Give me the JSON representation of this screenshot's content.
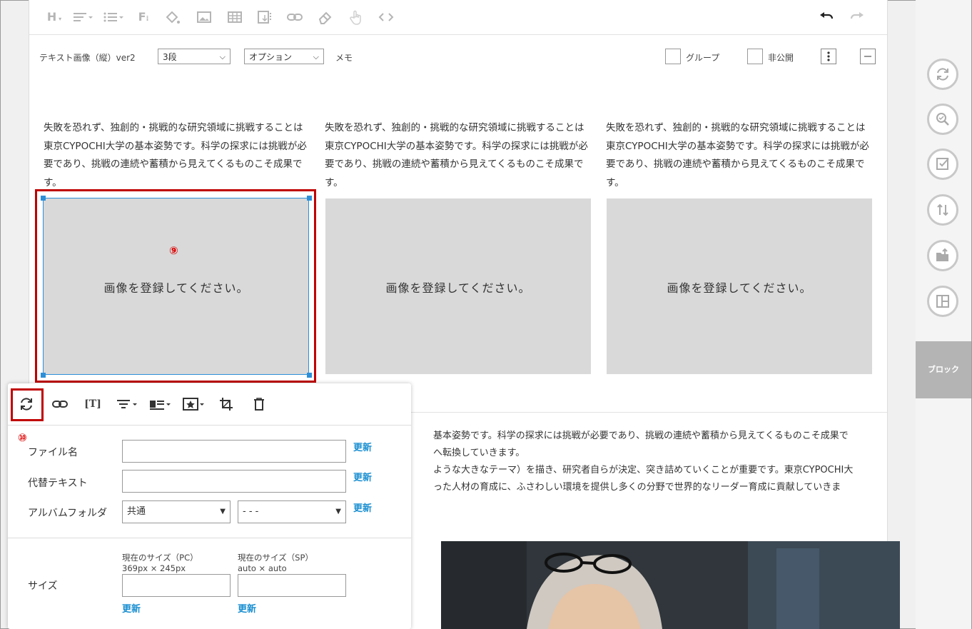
{
  "toolbar": {
    "icons": [
      "heading-icon",
      "align-icon",
      "list-icon",
      "font-icon",
      "fill-color-icon",
      "image-icon",
      "table-icon",
      "file-icon",
      "link-icon",
      "eraser-icon",
      "hand-icon",
      "code-icon",
      "undo-icon",
      "redo-icon"
    ],
    "heading_letter": "H",
    "font_letter": "F"
  },
  "block": {
    "name": "テキスト画像（縦）ver2",
    "columns_value": "3段",
    "option_value": "オプション",
    "memo_label": "メモ",
    "group_label": "グループ",
    "private_label": "非公開"
  },
  "columns": [
    {
      "text": "失敗を恐れず、独創的・挑戦的な研究領域に挑戦することは東京CYPOCHI大学の基本姿勢です。科学の探求には挑戦が必要であり、挑戦の連続や蓄積から見えてくるものこそ成果です。",
      "placeholder": "画像を登録してください。"
    },
    {
      "text": "失敗を恐れず、独創的・挑戦的な研究領域に挑戦することは東京CYPOCHI大学の基本姿勢です。科学の探求には挑戦が必要であり、挑戦の連続や蓄積から見えてくるものこそ成果です。",
      "placeholder": "画像を登録してください。"
    },
    {
      "text": "失敗を恐れず、独創的・挑戦的な研究領域に挑戦することは東京CYPOCHI大学の基本姿勢です。科学の探求には挑戦が必要であり、挑戦の連続や蓄積から見えてくるものこそ成果です。",
      "placeholder": "画像を登録してください。"
    }
  ],
  "markers": {
    "image": "⑨",
    "refresh": "⑩"
  },
  "paragraph": {
    "line1": "基本姿勢です。科学の探求には挑戦が必要であり、挑戦の連続や蓄積から見えてくるものこそ成果で",
    "line2": "へ転換していきます。",
    "line3": "ような大きなテーマ）を描き、研究者自らが決定、突き詰めていくことが重要です。東京CYPOCHI大",
    "line4": "った人材の育成に、ふさわしい環境を提供し多くの分野で世界的なリーダー育成に貢献していきま"
  },
  "right_panel": {
    "icons": [
      "refresh-icon",
      "zoom-icon",
      "checkbox-icon",
      "sort-icon",
      "folder-upload-icon",
      "layout-icon"
    ],
    "block_label": "ブロック"
  },
  "popup": {
    "tools": [
      "refresh-icon",
      "link-icon",
      "text-icon",
      "align-icon",
      "layout-icon",
      "star-icon",
      "crop-icon",
      "trash-icon"
    ],
    "text_tool_glyph": "T",
    "filename_label": "ファイル名",
    "filename_value": "",
    "alt_label": "代替テキスト",
    "alt_value": "",
    "album_label": "アルバムフォルダ",
    "album_value": "共通",
    "album_sub_value": "- - -",
    "update_label": "更新",
    "size_label": "サイズ",
    "pc_size_label": "現在のサイズ（PC）",
    "pc_size_value": "369px × 245px",
    "sp_size_label": "現在のサイズ（SP）",
    "sp_size_value": "auto × auto",
    "pc_input_value": "",
    "sp_input_value": ""
  },
  "colors": {
    "accent_red": "#c00000",
    "selection_blue": "#2d8fd8",
    "link_blue": "#1a8fd1",
    "placeholder_gray": "#d9d9d9"
  }
}
